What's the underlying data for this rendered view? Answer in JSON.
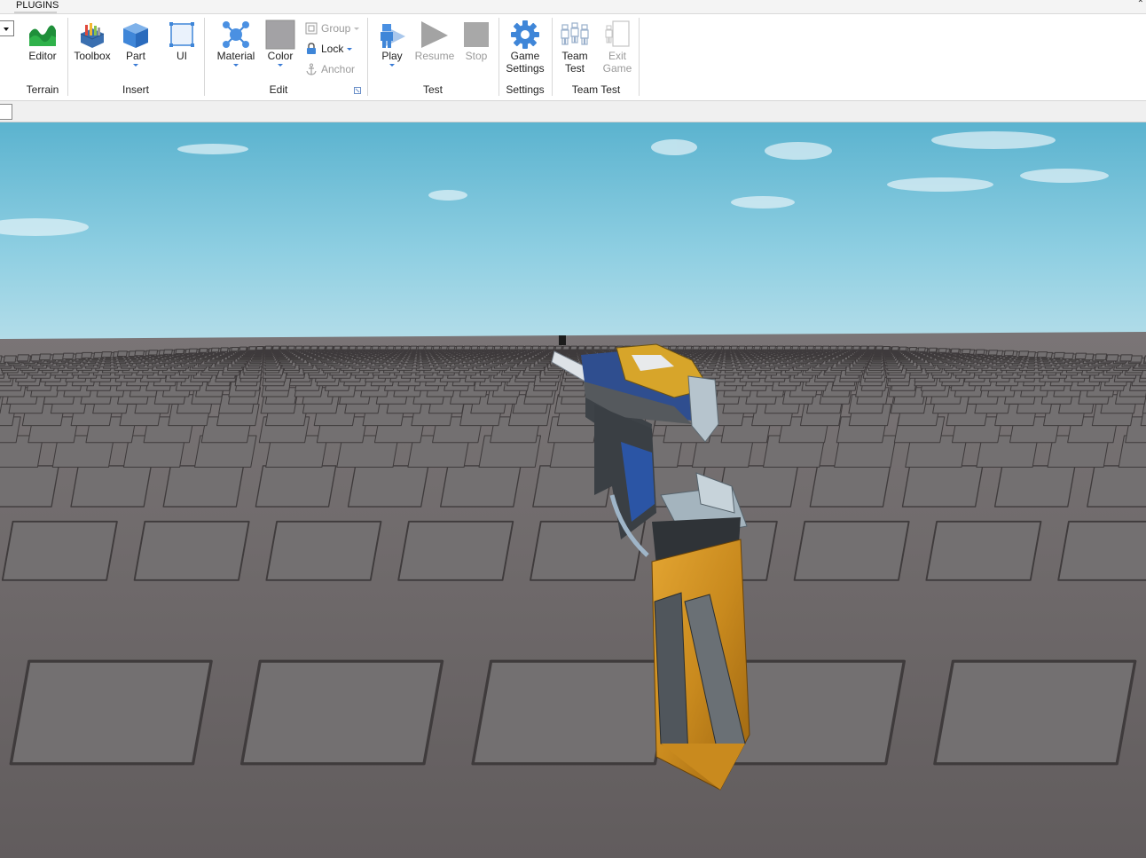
{
  "tab": {
    "label": "PLUGINS"
  },
  "ribbon": {
    "groups": [
      {
        "label": "Terrain",
        "buttons": [
          {
            "label": "Editor",
            "icon": "terrain-editor-icon"
          }
        ]
      },
      {
        "label": "Insert",
        "buttons": [
          {
            "label": "Toolbox",
            "icon": "toolbox-icon"
          },
          {
            "label": "Part",
            "icon": "part-cube-icon",
            "has_dropdown": true
          },
          {
            "label": "UI",
            "icon": "ui-frame-icon"
          }
        ]
      },
      {
        "label": "Edit",
        "buttons": [
          {
            "label": "Material",
            "icon": "material-icon",
            "has_dropdown": true
          },
          {
            "label": "Color",
            "icon": "color-swatch-icon",
            "has_dropdown": true
          }
        ],
        "small_buttons": [
          {
            "label": "Group",
            "icon": "group-icon",
            "enabled": false,
            "has_dropdown": true
          },
          {
            "label": "Lock",
            "icon": "lock-icon",
            "enabled": true,
            "has_dropdown": true
          },
          {
            "label": "Anchor",
            "icon": "anchor-icon",
            "enabled": false
          }
        ]
      },
      {
        "label": "Test",
        "buttons": [
          {
            "label": "Play",
            "icon": "play-icon",
            "has_dropdown": true
          },
          {
            "label": "Resume",
            "icon": "resume-icon",
            "enabled": false
          },
          {
            "label": "Stop",
            "icon": "stop-icon",
            "enabled": false
          }
        ]
      },
      {
        "label": "Settings",
        "buttons": [
          {
            "label_line1": "Game",
            "label_line2": "Settings",
            "icon": "gear-icon"
          }
        ]
      },
      {
        "label": "Team Test",
        "buttons": [
          {
            "label_line1": "Team",
            "label_line2": "Test",
            "icon": "team-test-icon",
            "enabled": true
          },
          {
            "label_line1": "Exit",
            "label_line2": "Game",
            "icon": "exit-game-icon",
            "enabled": false
          }
        ]
      }
    ]
  },
  "colors": {
    "accent": "#3a7bd5",
    "sky_top": "#5bb3cf",
    "sky_bottom": "#a9d7e6",
    "baseplate": "#6e6a6b",
    "disabled_text": "#9a9a9a"
  }
}
